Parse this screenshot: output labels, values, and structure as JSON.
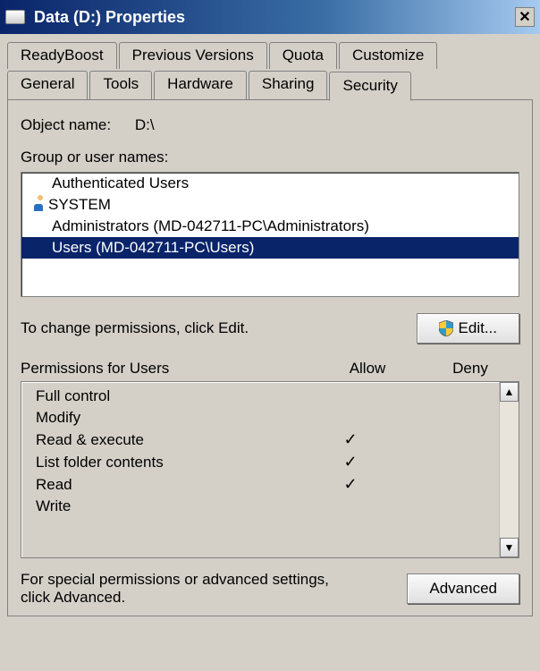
{
  "title": "Data (D:) Properties",
  "tabs_row1": [
    {
      "label": "ReadyBoost"
    },
    {
      "label": "Previous Versions"
    },
    {
      "label": "Quota"
    },
    {
      "label": "Customize"
    }
  ],
  "tabs_row2": [
    {
      "label": "General"
    },
    {
      "label": "Tools"
    },
    {
      "label": "Hardware"
    },
    {
      "label": "Sharing"
    },
    {
      "label": "Security",
      "active": true
    }
  ],
  "object_name_label": "Object name:",
  "object_name_value": "D:\\",
  "group_label": "Group or user names:",
  "users": [
    {
      "label": "Authenticated Users",
      "icon": "multi"
    },
    {
      "label": "SYSTEM",
      "icon": "single"
    },
    {
      "label": "Administrators (MD-042711-PC\\Administrators)",
      "icon": "multi"
    },
    {
      "label": "Users (MD-042711-PC\\Users)",
      "icon": "multi",
      "selected": true
    }
  ],
  "edit_note": "To change permissions, click Edit.",
  "edit_button": "Edit...",
  "permissions_header": "Permissions for Users",
  "col_allow": "Allow",
  "col_deny": "Deny",
  "permissions": [
    {
      "name": "Full control",
      "allow": false,
      "deny": false
    },
    {
      "name": "Modify",
      "allow": false,
      "deny": false
    },
    {
      "name": "Read & execute",
      "allow": true,
      "deny": false
    },
    {
      "name": "List folder contents",
      "allow": true,
      "deny": false
    },
    {
      "name": "Read",
      "allow": true,
      "deny": false
    },
    {
      "name": "Write",
      "allow": false,
      "deny": false
    }
  ],
  "advanced_note": "For special permissions or advanced settings, click Advanced.",
  "advanced_button": "Advanced"
}
